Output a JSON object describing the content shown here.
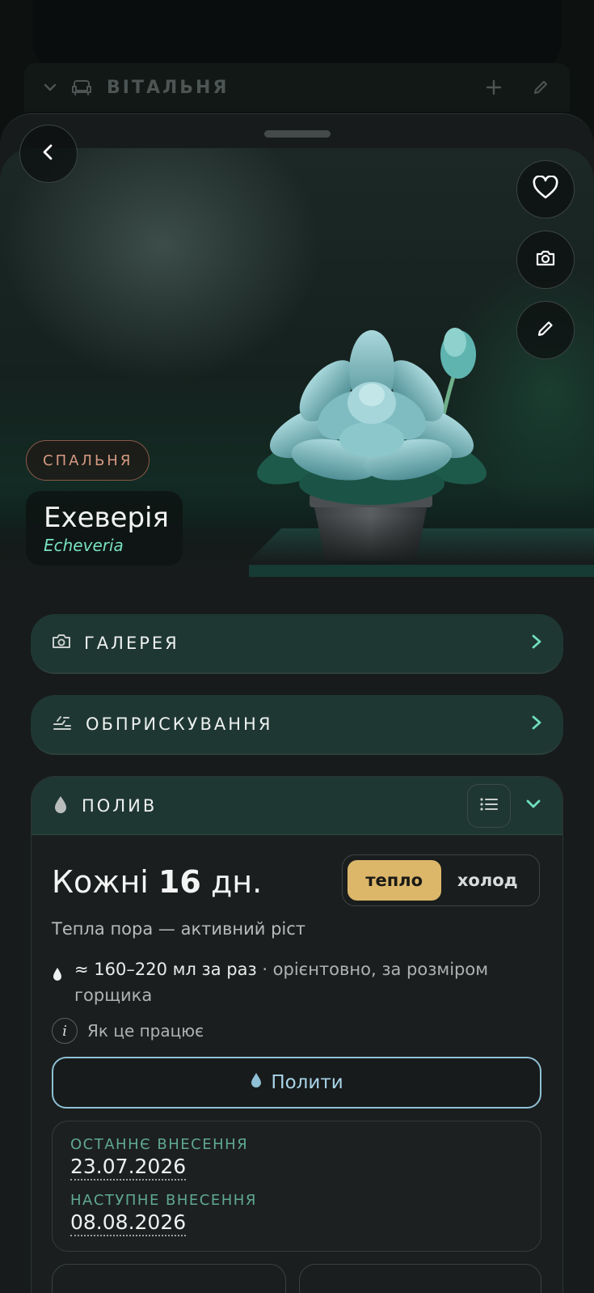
{
  "background_room": {
    "title": "ВІТАЛЬНЯ",
    "icons": [
      "chevron-down-icon",
      "sofa-icon",
      "plus-icon",
      "pencil-icon"
    ]
  },
  "hero": {
    "room_chip": "СПАЛЬНЯ",
    "plant_name": "Ехеверія",
    "plant_latin": "Echeveria",
    "actions": [
      "back-icon",
      "heart-icon",
      "camera-icon",
      "pencil-icon"
    ]
  },
  "sections": {
    "gallery": "ГАЛЕРЕЯ",
    "spraying": "ОБПРИСКУВАННЯ",
    "watering": "ПОЛИВ"
  },
  "watering": {
    "freq_prefix": "Кожні",
    "freq_value": "16",
    "freq_unit": "дн.",
    "toggle_warm": "тепло",
    "toggle_cold": "холод",
    "active_mode": "тепло",
    "season_text": "Тепла пора — активний ріст",
    "amount_main": "≈ 160–220 мл за раз",
    "amount_note": " · орієнтовно, за розміром горщика",
    "how_it_works": "Як це працює",
    "pour_button": "Полити",
    "last_label": "ОСТАННЄ ВНЕСЕННЯ",
    "last_date": "23.07.2026",
    "next_label": "НАСТУПНЕ ВНЕСЕННЯ",
    "next_date": "08.08.2026"
  },
  "colors": {
    "accent_teal": "#78e1c1",
    "row_bg": "#1f3732",
    "warm_active": "#dcb76a",
    "pour_blue": "#a9d4e8",
    "room_chip": "#d59a82"
  }
}
